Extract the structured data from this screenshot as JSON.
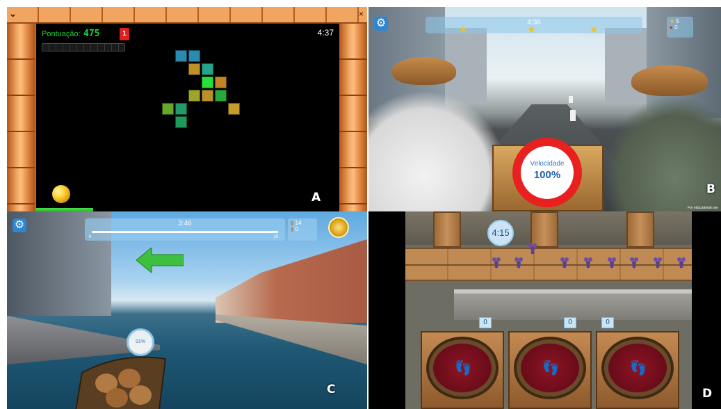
{
  "panel_a": {
    "letter": "A",
    "score_label": "Pontuação:",
    "score": "475",
    "bonus_count": "1",
    "time": "4:37",
    "window_close": "×",
    "window_menu": "⌄"
  },
  "panel_b": {
    "letter": "B",
    "time": "4:38",
    "stat_top": "5",
    "stat_bottom": "0",
    "speed_label": "Velocidade",
    "speed_value": "100%",
    "footer_note": "For educational use"
  },
  "panel_c": {
    "letter": "C",
    "time": "3:46",
    "track_start": "0",
    "track_end": "10",
    "stat_top": "14",
    "stat_bottom": "0",
    "indicator": "91%"
  },
  "panel_d": {
    "letter": "D",
    "time": "4:15",
    "tub_counts": [
      "0",
      "0",
      "0"
    ]
  },
  "colors": {
    "score_green": "#19d43a",
    "brick_orange": "#e99958",
    "hud_blue": "#2f86d0",
    "stop_red": "#e82020"
  }
}
